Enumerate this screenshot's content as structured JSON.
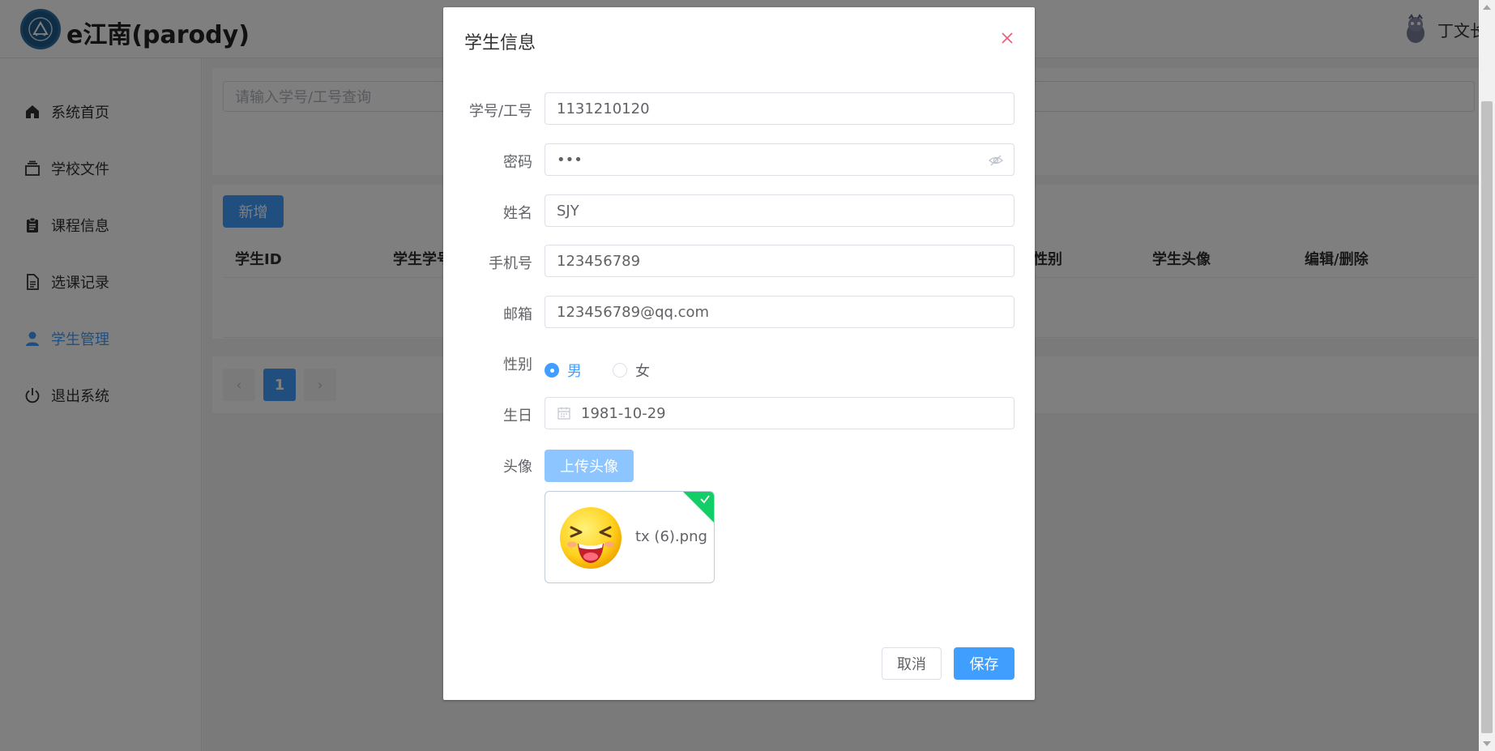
{
  "app": {
    "brand": "e江南(parody)",
    "user_name": "丁文长"
  },
  "sidebar": {
    "items": [
      {
        "label": "系统首页",
        "icon": "home-icon"
      },
      {
        "label": "学校文件",
        "icon": "file-stack-icon"
      },
      {
        "label": "课程信息",
        "icon": "clipboard-icon"
      },
      {
        "label": "选课记录",
        "icon": "document-icon"
      },
      {
        "label": "学生管理",
        "icon": "user-icon",
        "active": true
      },
      {
        "label": "退出系统",
        "icon": "power-icon"
      }
    ]
  },
  "main": {
    "search_placeholder": "请输入学号/工号查询",
    "add_label": "新增",
    "columns": [
      "学生ID",
      "学生学号",
      "性别",
      "学生头像",
      "编辑/删除"
    ],
    "pagination": {
      "prev": "‹",
      "current": "1",
      "next": "›"
    }
  },
  "dialog": {
    "title": "学生信息",
    "fields": {
      "id": {
        "label": "学号/工号",
        "value": "1131210120"
      },
      "password": {
        "label": "密码",
        "value": "•••"
      },
      "name": {
        "label": "姓名",
        "value": "SJY"
      },
      "phone": {
        "label": "手机号",
        "value": "123456789"
      },
      "email": {
        "label": "邮箱",
        "value": "123456789@qq.com"
      },
      "gender": {
        "label": "性别",
        "options": [
          "男",
          "女"
        ],
        "selected": "男"
      },
      "birthday": {
        "label": "生日",
        "value": "1981-10-29"
      },
      "avatar": {
        "label": "头像",
        "upload_label": "上传头像",
        "file_name": "tx (6).png"
      }
    },
    "cancel_label": "取消",
    "save_label": "保存"
  },
  "colors": {
    "primary": "#409eff",
    "success": "#13ce66",
    "overlay": "rgba(0,0,0,0.5)"
  }
}
